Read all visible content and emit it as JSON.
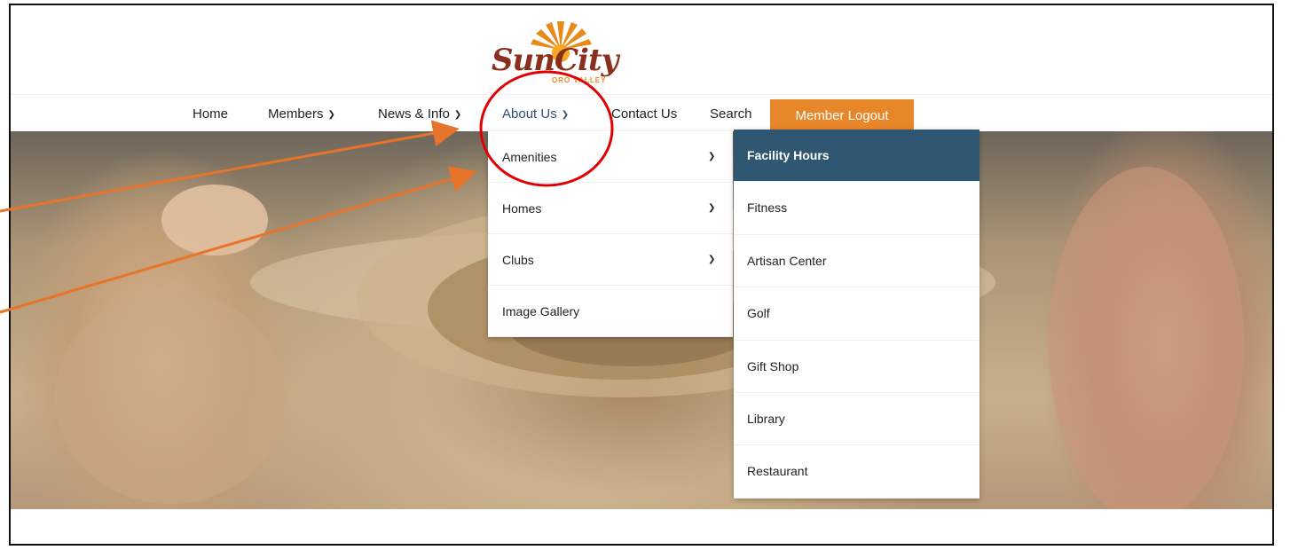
{
  "logo": {
    "name": "SunCity",
    "subtitle": "ORO VALLEY"
  },
  "nav": {
    "items": [
      {
        "label": "Home"
      },
      {
        "label": "Members",
        "chevron": "chevron-down-icon"
      },
      {
        "label": "News & Info",
        "chevron": "chevron-down-icon"
      },
      {
        "label": "About Us",
        "chevron": "chevron-down-icon",
        "active": true
      },
      {
        "label": "Contact Us"
      },
      {
        "label": "Search"
      }
    ],
    "logout_label": "Member Logout"
  },
  "about_dropdown": {
    "items": [
      {
        "label": "Amenities",
        "has_submenu": true
      },
      {
        "label": "Homes",
        "has_submenu": true
      },
      {
        "label": "Clubs",
        "has_submenu": true
      },
      {
        "label": "Image Gallery",
        "has_submenu": false
      }
    ]
  },
  "amenities_submenu": {
    "items": [
      {
        "label": "Facility Hours",
        "active": true
      },
      {
        "label": "Fitness"
      },
      {
        "label": "Artisan Center"
      },
      {
        "label": "Golf"
      },
      {
        "label": "Gift Shop"
      },
      {
        "label": "Library"
      },
      {
        "label": "Restaurant"
      }
    ]
  },
  "colors": {
    "accent_orange": "#e8872a",
    "nav_active": "#2c5276",
    "submenu_active_bg": "#2f5771",
    "annotation_circle": "#e00000",
    "annotation_arrow": "#e8732a",
    "logo_brown": "#8a2f1c"
  }
}
